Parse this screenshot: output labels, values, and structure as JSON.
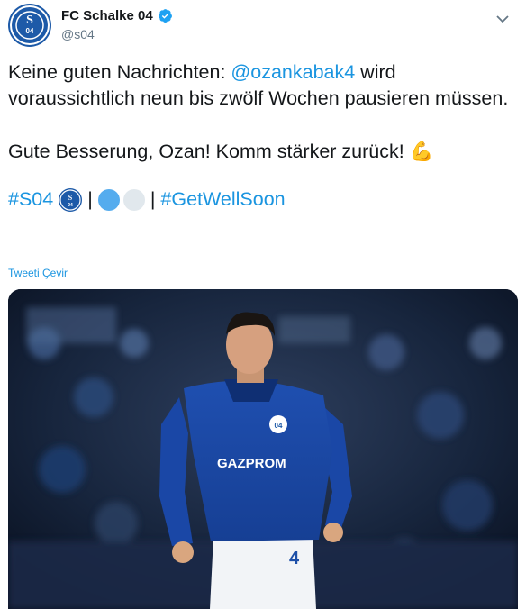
{
  "account": {
    "display_name": "FC Schalke 04",
    "handle": "@s04",
    "verified": true,
    "avatar_text": "S04"
  },
  "tweet": {
    "line1_prefix": "Keine guten Nachrichten: ",
    "mention": "@ozankabak4",
    "line1_suffix": " wird voraussichtlich neun bis zwölf Wochen pausieren müssen.",
    "line2": "Gute Besserung, Ozan! Komm stärker zurück! ",
    "emoji_flex": "💪",
    "hashtag_1": "#S04",
    "separator_1": "|",
    "separator_2": "|",
    "hashtag_2": "#GetWellSoon",
    "translate_link": "Tweeti Çevir"
  },
  "media": {
    "jersey_number": "4",
    "sponsor_text": "GAZPROM",
    "crest_text": "04"
  },
  "colors": {
    "link": "#1b95e0",
    "schalke_blue": "#1d5aa8",
    "dot_blue": "#55acee",
    "dot_white": "#e1e8ed"
  }
}
